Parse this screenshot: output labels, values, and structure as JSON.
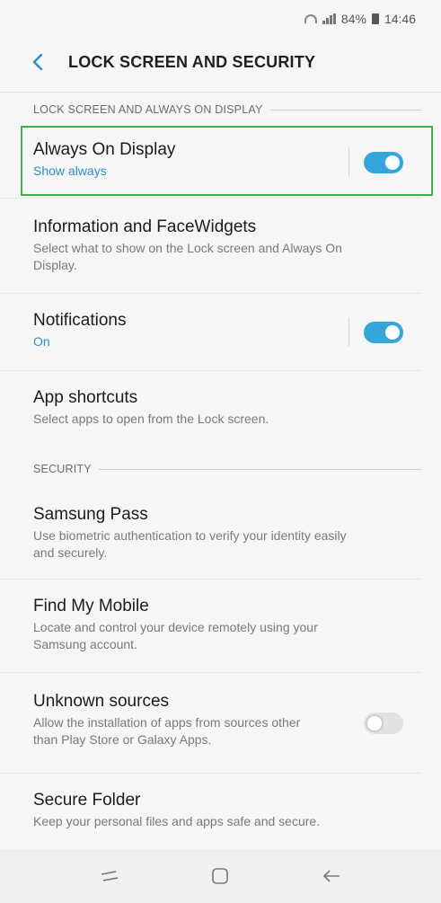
{
  "status_bar": {
    "battery": "84%",
    "time": "14:46"
  },
  "header": {
    "title": "LOCK SCREEN AND SECURITY"
  },
  "sections": {
    "lock_screen": "LOCK SCREEN AND ALWAYS ON DISPLAY",
    "security": "SECURITY"
  },
  "items": {
    "always_on": {
      "title": "Always On Display",
      "subtitle": "Show always",
      "toggle": "on"
    },
    "info_facewidgets": {
      "title": "Information and FaceWidgets",
      "subtitle": "Select what to show on the Lock screen and Always On Display."
    },
    "notifications": {
      "title": "Notifications",
      "subtitle": "On",
      "toggle": "on"
    },
    "app_shortcuts": {
      "title": "App shortcuts",
      "subtitle": "Select apps to open from the Lock screen."
    },
    "samsung_pass": {
      "title": "Samsung Pass",
      "subtitle": "Use biometric authentication to verify your identity easily and securely."
    },
    "find_my_mobile": {
      "title": "Find My Mobile",
      "subtitle": "Locate and control your device remotely using your Samsung account."
    },
    "unknown_sources": {
      "title": "Unknown sources",
      "subtitle": "Allow the installation of apps from sources other than Play Store or Galaxy Apps.",
      "toggle": "off"
    },
    "secure_folder": {
      "title": "Secure Folder",
      "subtitle": "Keep your personal files and apps safe and secure."
    }
  },
  "colors": {
    "accent": "#35a6dc",
    "highlight": "#3db24a",
    "subtitle_blue": "#2a8fc6"
  },
  "icons": {
    "back": "back-arrow-icon",
    "recents": "recents-icon",
    "home": "home-icon",
    "nav_back": "nav-back-icon"
  }
}
